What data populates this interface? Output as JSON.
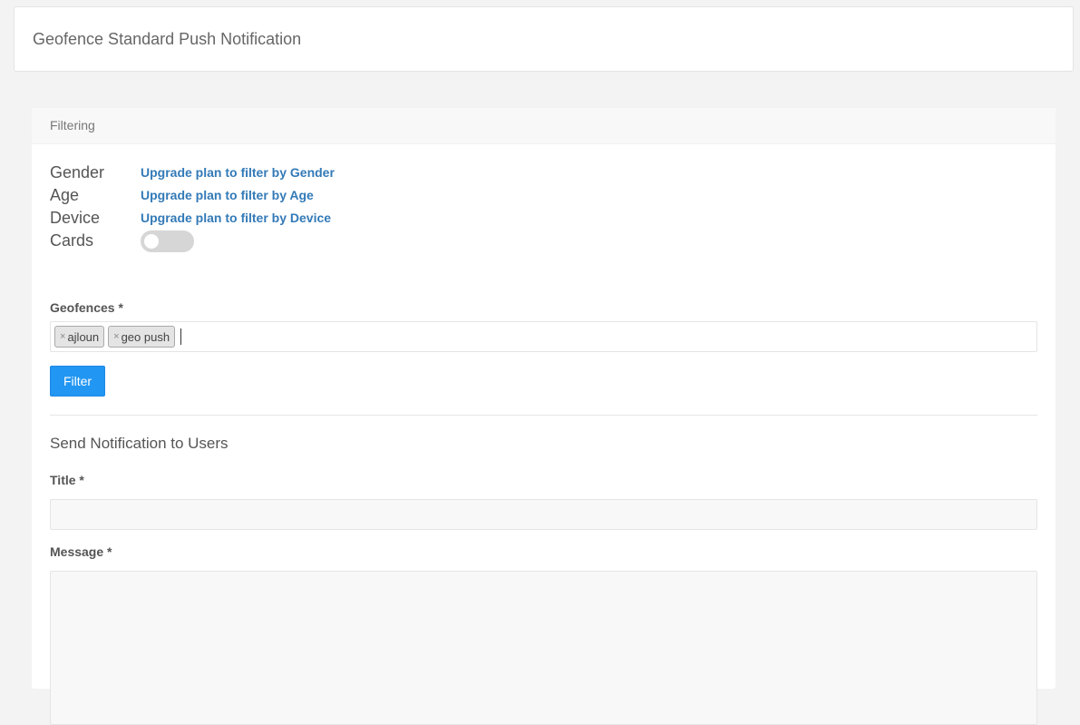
{
  "header": {
    "title": "Geofence Standard Push Notification"
  },
  "filtering": {
    "heading": "Filtering",
    "rows": [
      {
        "label": "Gender",
        "link": "Upgrade plan to filter by Gender"
      },
      {
        "label": "Age",
        "link": "Upgrade plan to filter by Age"
      },
      {
        "label": "Device",
        "link": "Upgrade plan to filter by Device"
      }
    ],
    "cards_label": "Cards",
    "cards_enabled": false,
    "geofences_label": "Geofences *",
    "geofences": [
      {
        "remove": "×",
        "label": "ajloun"
      },
      {
        "remove": "×",
        "label": "geo push"
      }
    ],
    "filter_button": "Filter"
  },
  "notification": {
    "heading": "Send Notification to Users",
    "title_label": "Title *",
    "title_value": "",
    "message_label": "Message *",
    "message_value": ""
  }
}
